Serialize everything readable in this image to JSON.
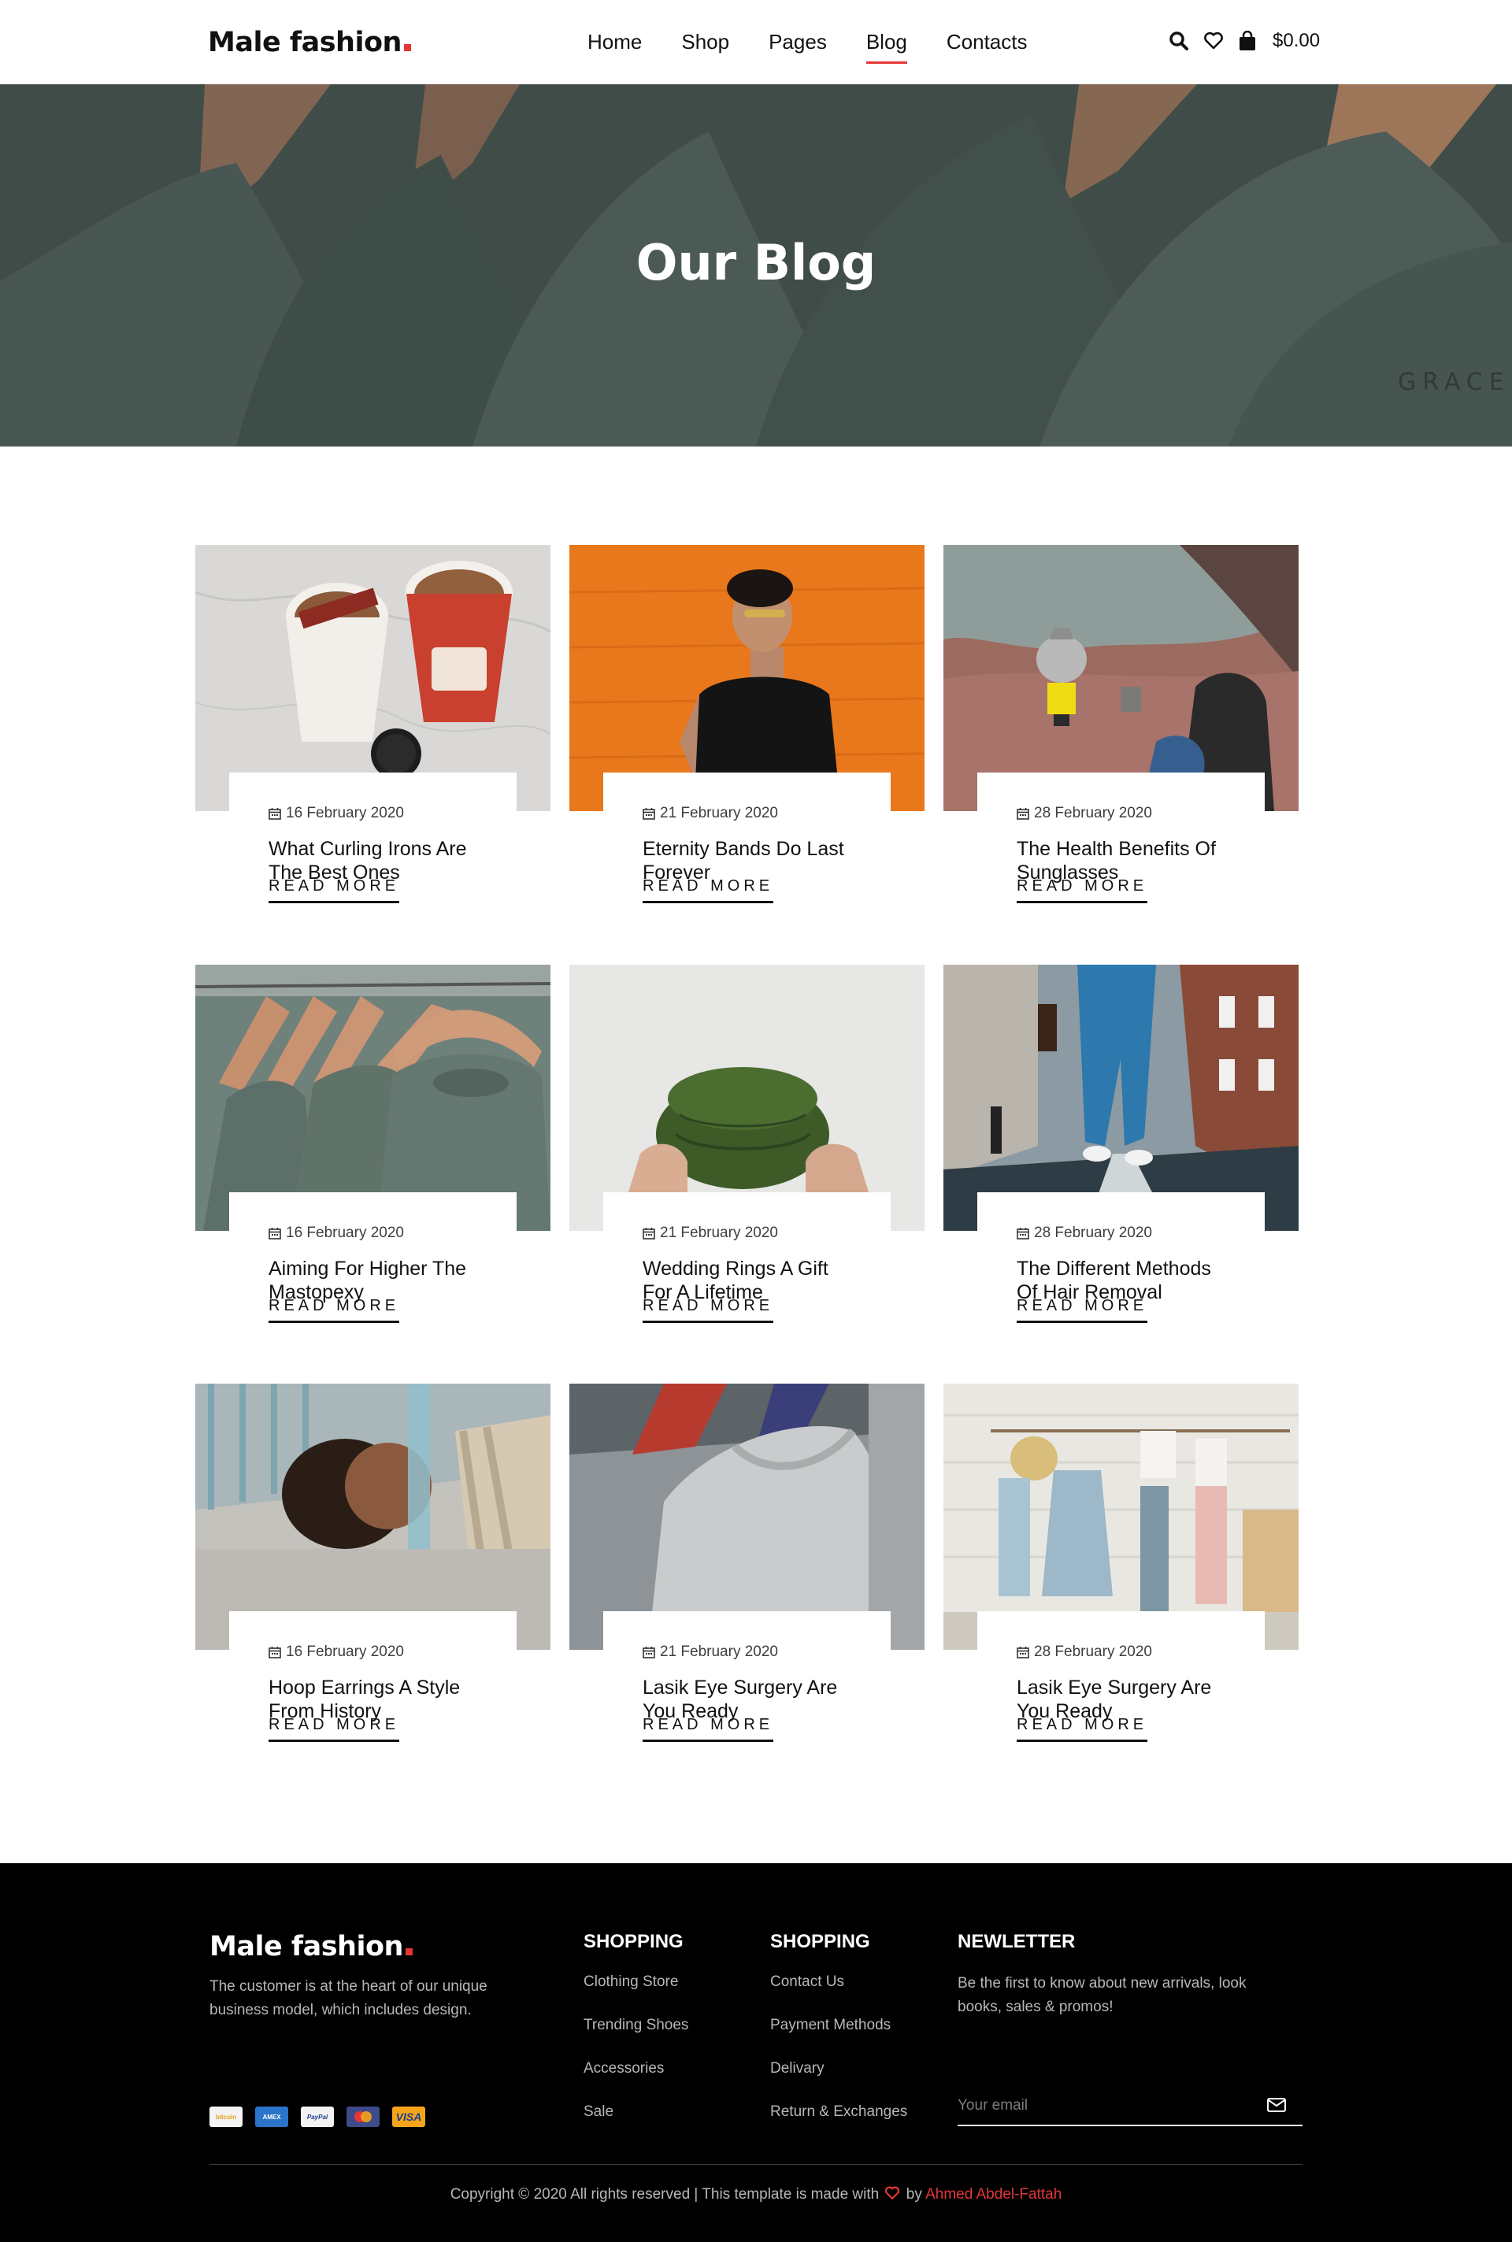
{
  "header": {
    "logo": "Male fashion",
    "nav": [
      "Home",
      "Shop",
      "Pages",
      "Blog",
      "Contacts"
    ],
    "active_nav": "Blog",
    "cart_total": "$0.00",
    "icons": [
      "search-icon",
      "heart-icon",
      "bag-icon"
    ]
  },
  "hero": {
    "title": "Our Blog"
  },
  "posts": [
    {
      "date": "16 February 2020",
      "title": "What Curling Irons Are The Best Ones",
      "more": "READ MORE"
    },
    {
      "date": "21 February 2020",
      "title": "Eternity Bands Do Last Forever",
      "more": "READ MORE"
    },
    {
      "date": "28 February 2020",
      "title": "The Health Benefits Of Sunglasses",
      "more": "READ MORE"
    },
    {
      "date": "16 February 2020",
      "title": "Aiming For Higher The Mastopexy",
      "more": "READ MORE"
    },
    {
      "date": "21 February 2020",
      "title": "Wedding Rings A Gift For A Lifetime",
      "more": "READ MORE"
    },
    {
      "date": "28 February 2020",
      "title": "The Different Methods Of Hair Removal",
      "more": "READ MORE"
    },
    {
      "date": "16 February 2020",
      "title": "Hoop Earrings A Style From History",
      "more": "READ MORE"
    },
    {
      "date": "21 February 2020",
      "title": "Lasik Eye Surgery Are You Ready",
      "more": "READ MORE"
    },
    {
      "date": "28 February 2020",
      "title": "Lasik Eye Surgery Are You Ready",
      "more": "READ MORE"
    }
  ],
  "footer": {
    "logo": "Male fashion",
    "about": "The customer is at the heart of our unique business model, which includes design.",
    "payments": [
      "bitcoin",
      "AMEX",
      "PayPal",
      "MasterCard",
      "VISA"
    ],
    "col1": {
      "title": "SHOPPING",
      "items": [
        "Clothing Store",
        "Trending Shoes",
        "Accessories",
        "Sale"
      ]
    },
    "col2": {
      "title": "SHOPPING",
      "items": [
        "Contact Us",
        "Payment Methods",
        "Delivary",
        "Return & Exchanges"
      ]
    },
    "newsletter": {
      "title": "NEWLETTER",
      "text": "Be the first to know about new arrivals, look books, sales & promos!",
      "placeholder": "Your email"
    },
    "copyright_prefix": "Copyright © 2020 All rights reserved | This template is made with",
    "copyright_by": "by",
    "author": "Ahmed Abdel-Fattah"
  },
  "colors": {
    "accent": "#e53637",
    "text": "#111111",
    "footer_bg": "#000000"
  }
}
